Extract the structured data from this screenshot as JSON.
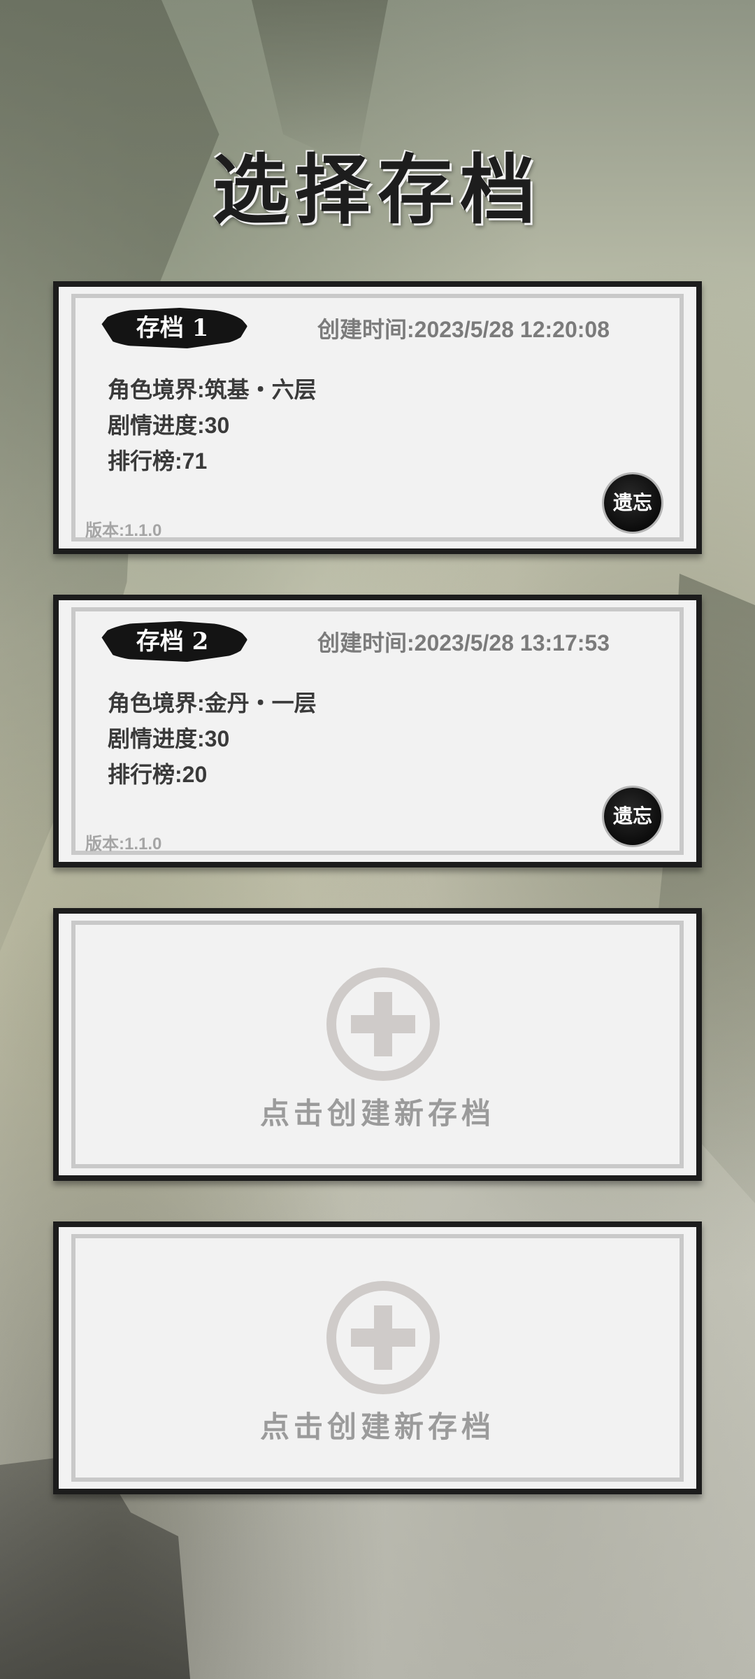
{
  "title": "选择存档",
  "saves": [
    {
      "slot_label": "存档 1",
      "created_time": "创建时间:2023/5/28 12:20:08",
      "realm": "角色境界:筑基・六层",
      "story_progress": "剧情进度:30",
      "ranking": "排行榜:71",
      "version": "版本:1.1.0",
      "forget_label": "遗忘"
    },
    {
      "slot_label": "存档 2",
      "created_time": "创建时间:2023/5/28 13:17:53",
      "realm": "角色境界:金丹・一层",
      "story_progress": "剧情进度:30",
      "ranking": "排行榜:20",
      "version": "版本:1.1.0",
      "forget_label": "遗忘"
    }
  ],
  "empty_slots": [
    {
      "label": "点击创建新存档",
      "icon": "plus-circle-icon"
    },
    {
      "label": "点击创建新存档",
      "icon": "plus-circle-icon"
    }
  ]
}
